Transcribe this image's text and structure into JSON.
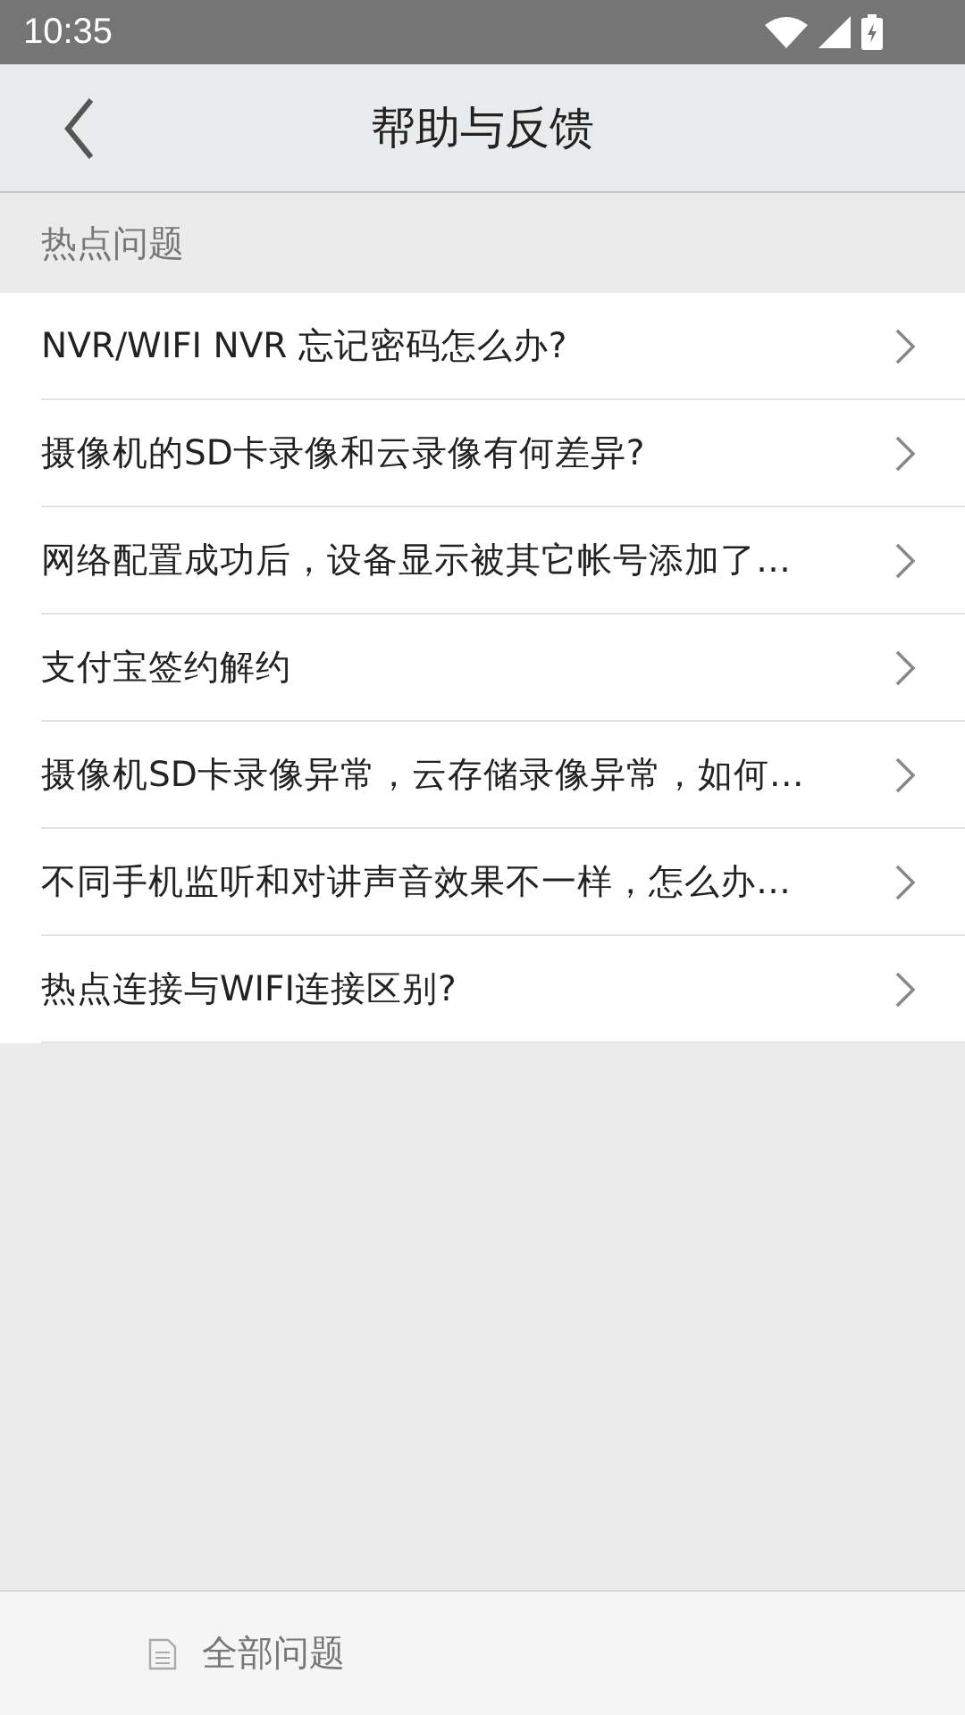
{
  "status_bar": {
    "time": "10:35"
  },
  "header": {
    "title": "帮助与反馈"
  },
  "section": {
    "title": "热点问题"
  },
  "questions": [
    {
      "text": "NVR/WIFI NVR 忘记密码怎么办?"
    },
    {
      "text": "摄像机的SD卡录像和云录像有何差异?"
    },
    {
      "text": "网络配置成功后，设备显示被其它帐号添加了…"
    },
    {
      "text": "支付宝签约解约"
    },
    {
      "text": "摄像机SD卡录像异常，云存储录像异常，如何…"
    },
    {
      "text": "不同手机监听和对讲声音效果不一样，怎么办…"
    },
    {
      "text": "热点连接与WIFI连接区别?"
    }
  ],
  "bottom_tabs": [
    {
      "label": "全部问题"
    }
  ]
}
